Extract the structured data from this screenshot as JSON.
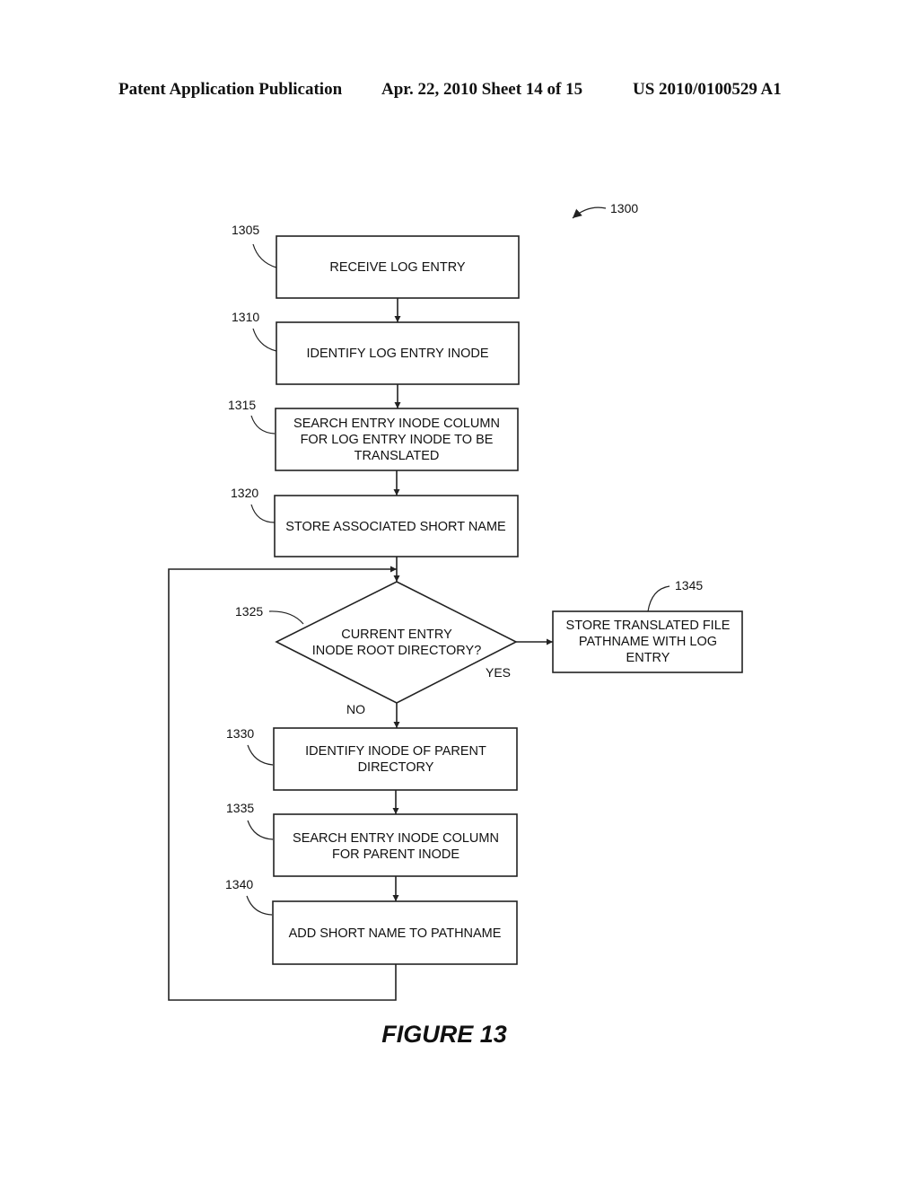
{
  "header": {
    "publication": "Patent Application Publication",
    "date_sheet": "Apr. 22, 2010  Sheet 14 of 15",
    "number": "US 2010/0100529 A1"
  },
  "diagram": {
    "ref": "1300",
    "figure_label": "FIGURE 13",
    "steps": [
      {
        "ref": "1305",
        "lines": [
          "RECEIVE LOG ENTRY"
        ]
      },
      {
        "ref": "1310",
        "lines": [
          "IDENTIFY LOG ENTRY INODE"
        ]
      },
      {
        "ref": "1315",
        "lines": [
          "SEARCH ENTRY INODE COLUMN",
          "FOR LOG ENTRY INODE TO BE",
          "TRANSLATED"
        ]
      },
      {
        "ref": "1320",
        "lines": [
          "STORE ASSOCIATED SHORT NAME"
        ]
      },
      {
        "ref": "1325",
        "lines": [
          "CURRENT ENTRY",
          "INODE ROOT DIRECTORY?"
        ]
      },
      {
        "ref": "1330",
        "lines": [
          "IDENTIFY INODE OF PARENT",
          "DIRECTORY"
        ]
      },
      {
        "ref": "1335",
        "lines": [
          "SEARCH ENTRY INODE COLUMN",
          "FOR PARENT INODE"
        ]
      },
      {
        "ref": "1340",
        "lines": [
          "ADD SHORT NAME TO PATHNAME"
        ]
      },
      {
        "ref": "1345",
        "lines": [
          "STORE TRANSLATED FILE",
          "PATHNAME WITH LOG",
          "ENTRY"
        ]
      }
    ],
    "branch_labels": {
      "yes": "YES",
      "no": "NO"
    }
  }
}
